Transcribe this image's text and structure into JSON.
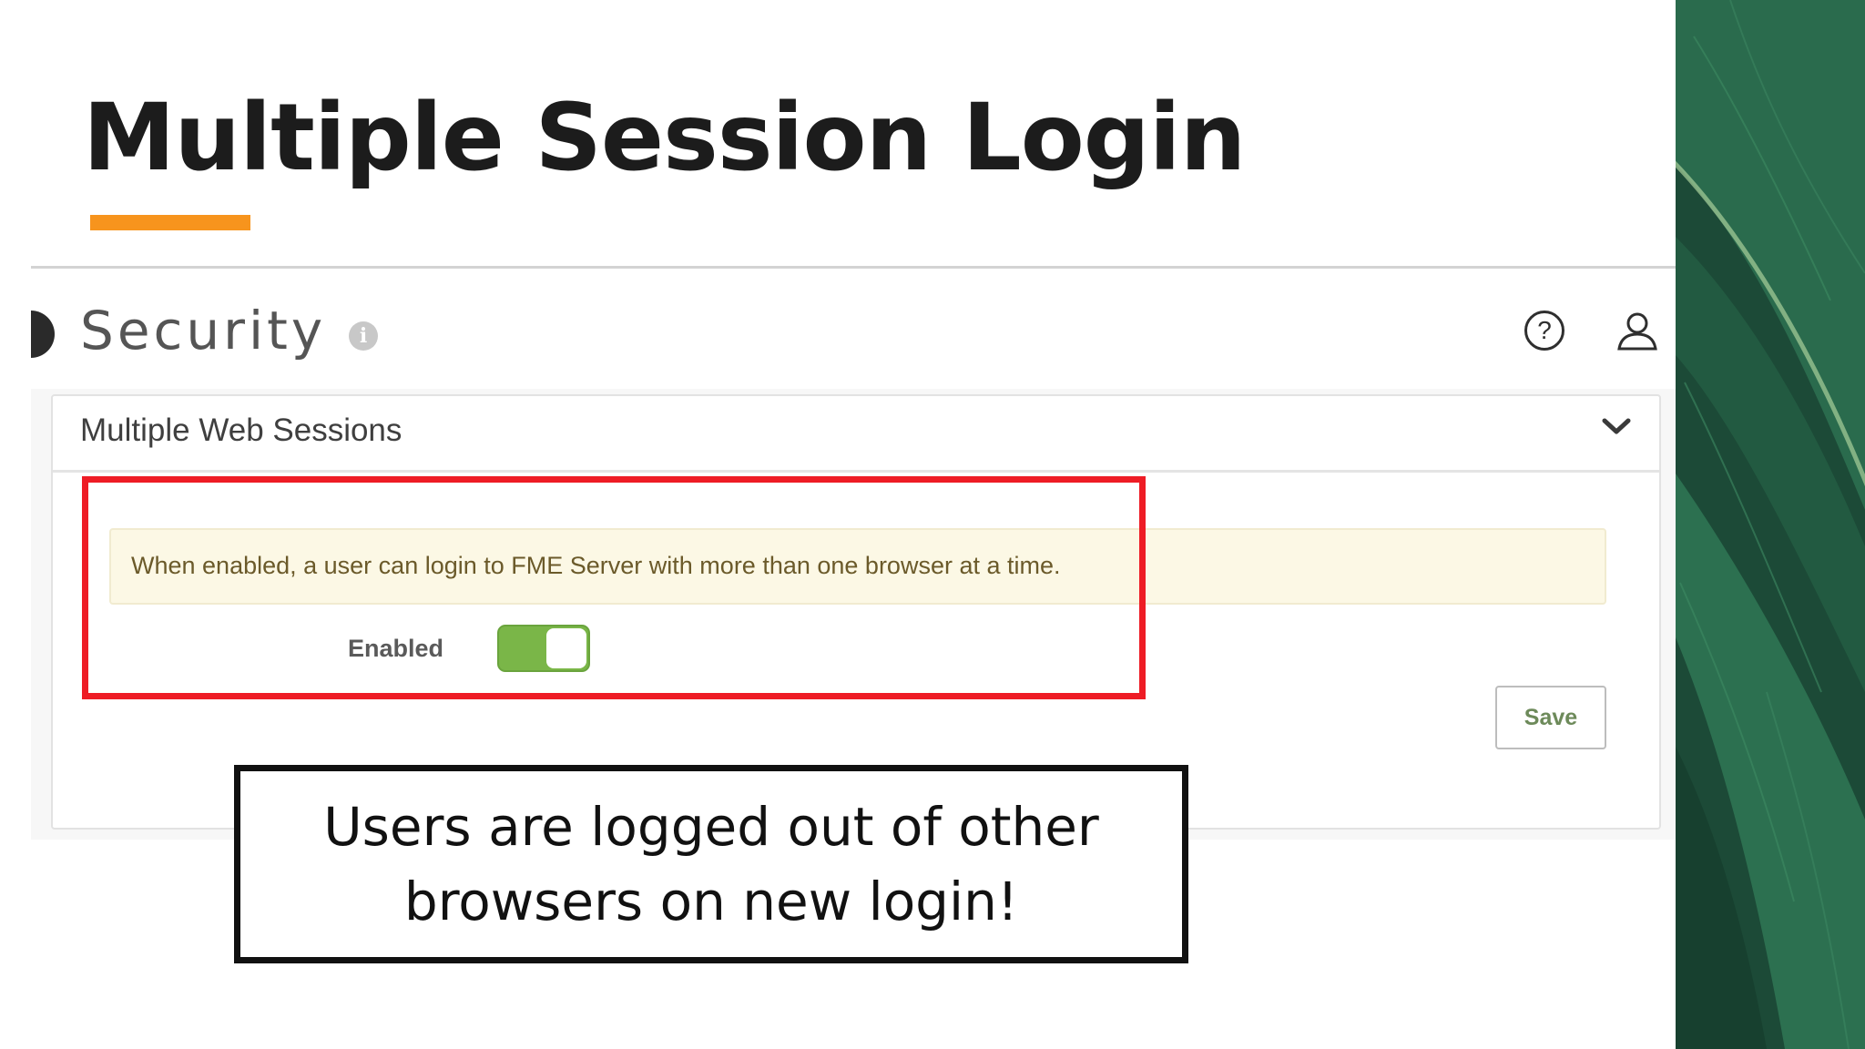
{
  "slide": {
    "title": "Multiple Session Login",
    "accent_color": "#f7941d"
  },
  "security": {
    "title": "Security",
    "info_icon": "info-icon",
    "help_icon": "question-circle-icon",
    "user_icon": "user-icon"
  },
  "panel": {
    "title": "Multiple Web Sessions",
    "collapse_icon": "chevron-down-icon",
    "description": "When enabled, a user can login to FME Server with more than one browser at a time.",
    "toggle_label": "Enabled",
    "toggle_state": true,
    "toggle_color": "#7ab648",
    "save_label": "Save"
  },
  "annotation": {
    "highlight_color": "#ee1c25",
    "callout_line1": "Users are logged out of other",
    "callout_line2": "browsers on new login!"
  },
  "decoration": {
    "leaf_color": "#1c4a37"
  }
}
